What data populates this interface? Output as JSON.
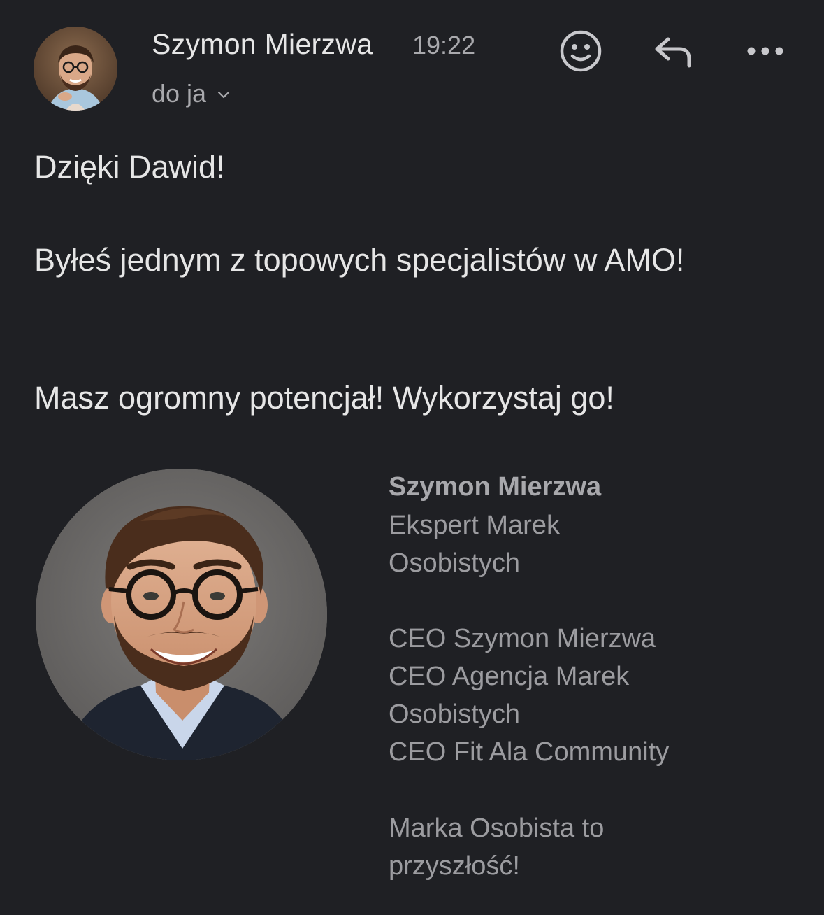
{
  "header": {
    "sender_name": "Szymon Mierzwa",
    "time": "19:22",
    "recipient": "do ja",
    "icons": {
      "emoji": "smiley-face-icon",
      "reply": "reply-arrow-icon",
      "more": "more-horizontal-icon",
      "chevron": "chevron-down-icon"
    }
  },
  "body": {
    "paragraphs": [
      "Dzięki Dawid!",
      "Byłeś jednym z topowych specjalistów w AMO!",
      "Masz ogromny potencjał! Wykorzystaj go!"
    ]
  },
  "signature": {
    "name": "Szymon Mierzwa",
    "title_lines": [
      "Ekspert Marek",
      "Osobistych"
    ],
    "role_lines": [
      "CEO Szymon Mierzwa",
      "CEO Agencja Marek",
      "Osobistych",
      "CEO Fit Ala Community"
    ],
    "motto_lines": [
      "Marka Osobista to",
      "przyszłość!"
    ]
  },
  "colors": {
    "background": "#1f2024",
    "primary_text": "#e6e6e6",
    "secondary_text": "#a9a9ad",
    "signature_text": "#9c9ca0"
  }
}
